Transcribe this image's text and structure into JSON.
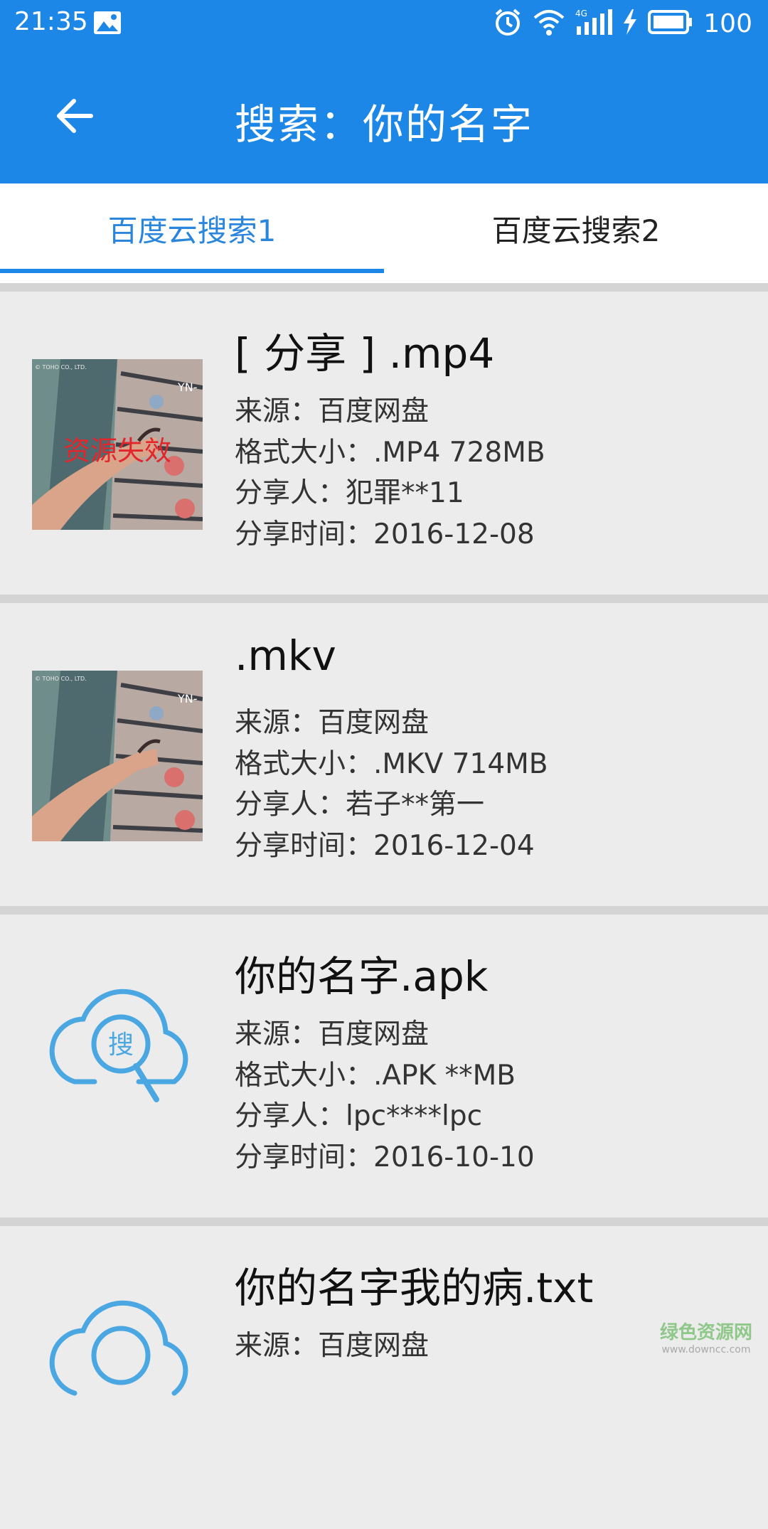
{
  "status_bar": {
    "time": "21:35",
    "battery": "100",
    "icons": [
      "photo-icon",
      "alarm-icon",
      "wifi-icon",
      "signal-4g-icon",
      "charging-icon",
      "battery-icon"
    ]
  },
  "app_bar": {
    "title": "搜索：你的名字",
    "back_icon": "arrow-left-icon",
    "color": "#1c87e6"
  },
  "tabs": [
    {
      "label": "百度云搜索1",
      "active": true
    },
    {
      "label": "百度云搜索2",
      "active": false
    }
  ],
  "results": [
    {
      "title": "[ 分享 ] .mp4",
      "source": "来源：百度网盘",
      "format_size": "格式大小：.MP4   728MB",
      "sharer": "分享人：犯罪**11",
      "share_time": "分享时间：2016-12-08",
      "thumb": "anime-still",
      "badge": "资源失效"
    },
    {
      "title": ".mkv",
      "source": "来源：百度网盘",
      "format_size": "格式大小：.MKV   714MB",
      "sharer": "分享人：若子**第一",
      "share_time": "分享时间：2016-12-04",
      "thumb": "anime-still"
    },
    {
      "title": "你的名字.apk",
      "source": "来源：百度网盘",
      "format_size": "格式大小：.APK   **MB",
      "sharer": "分享人：lpc****lpc",
      "share_time": "分享时间：2016-10-10",
      "thumb": "cloud-search-icon",
      "thumb_label": "搜"
    },
    {
      "title": "你的名字我的病.txt",
      "source": "来源：百度网盘",
      "thumb": "cloud-search-icon"
    }
  ],
  "watermark": {
    "main": "绿色资源网",
    "sub": "www.downcc.com"
  }
}
